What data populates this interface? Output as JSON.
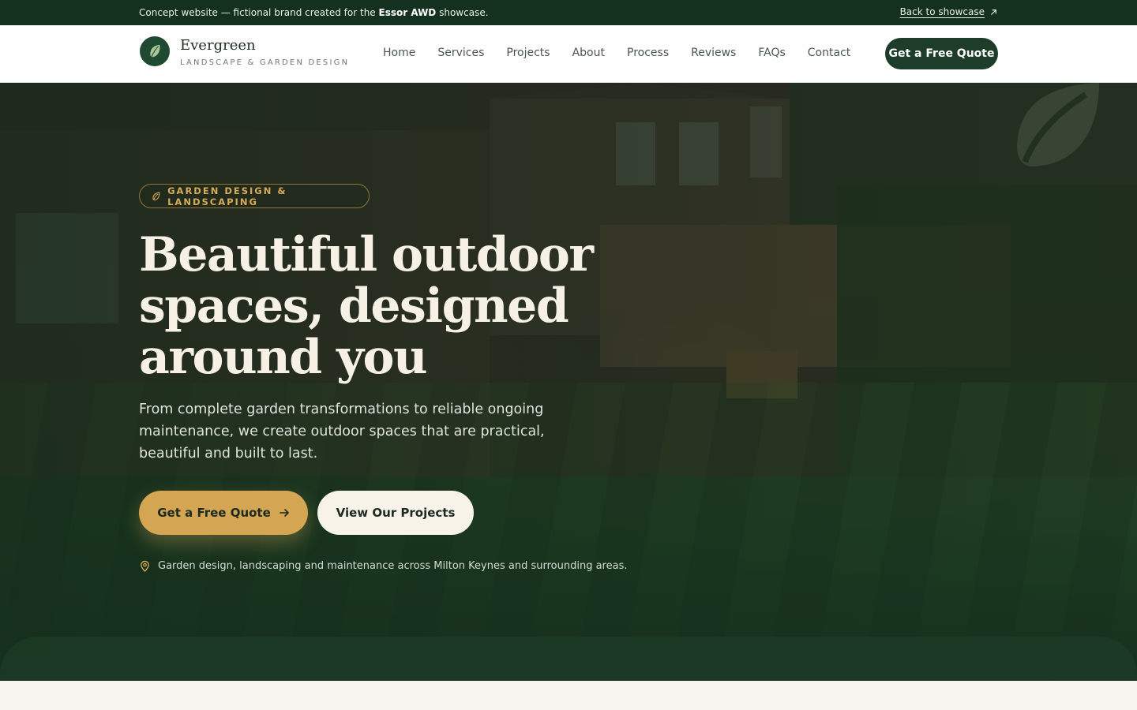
{
  "topbar": {
    "note_prefix": "Concept website — fictional brand created for the ",
    "note_brand": "Essor AWD",
    "note_suffix": " showcase.",
    "back_label": "Back to showcase"
  },
  "header": {
    "brand_name": "Evergreen",
    "brand_tagline": "LANDSCAPE & GARDEN DESIGN",
    "nav": [
      "Home",
      "Services",
      "Projects",
      "About",
      "Process",
      "Reviews",
      "FAQs",
      "Contact"
    ],
    "cta_label": "Get a Free Quote"
  },
  "hero": {
    "badge": "GARDEN DESIGN & LANDSCAPING",
    "title_lines": [
      "Beautiful outdoor",
      "spaces, designed",
      "around you"
    ],
    "subtitle": "From complete garden transformations to reliable ongoing maintenance, we create outdoor spaces that are practical, beautiful and built to last.",
    "primary_cta": "Get a Free Quote",
    "secondary_cta": "View Our Projects",
    "area_note": "Garden design, landscaping and maintenance across Milton Keynes and surrounding areas."
  },
  "colors": {
    "dark_green": "#14301f",
    "brand_green": "#1d3d2a",
    "gold": "#d4a553",
    "cream": "#f7f3e9"
  },
  "icons": {
    "logo": "leaf-icon",
    "back": "arrow-up-right-icon",
    "badge": "leaf-icon",
    "primary_cta": "arrow-right-icon",
    "area": "map-pin-icon"
  }
}
